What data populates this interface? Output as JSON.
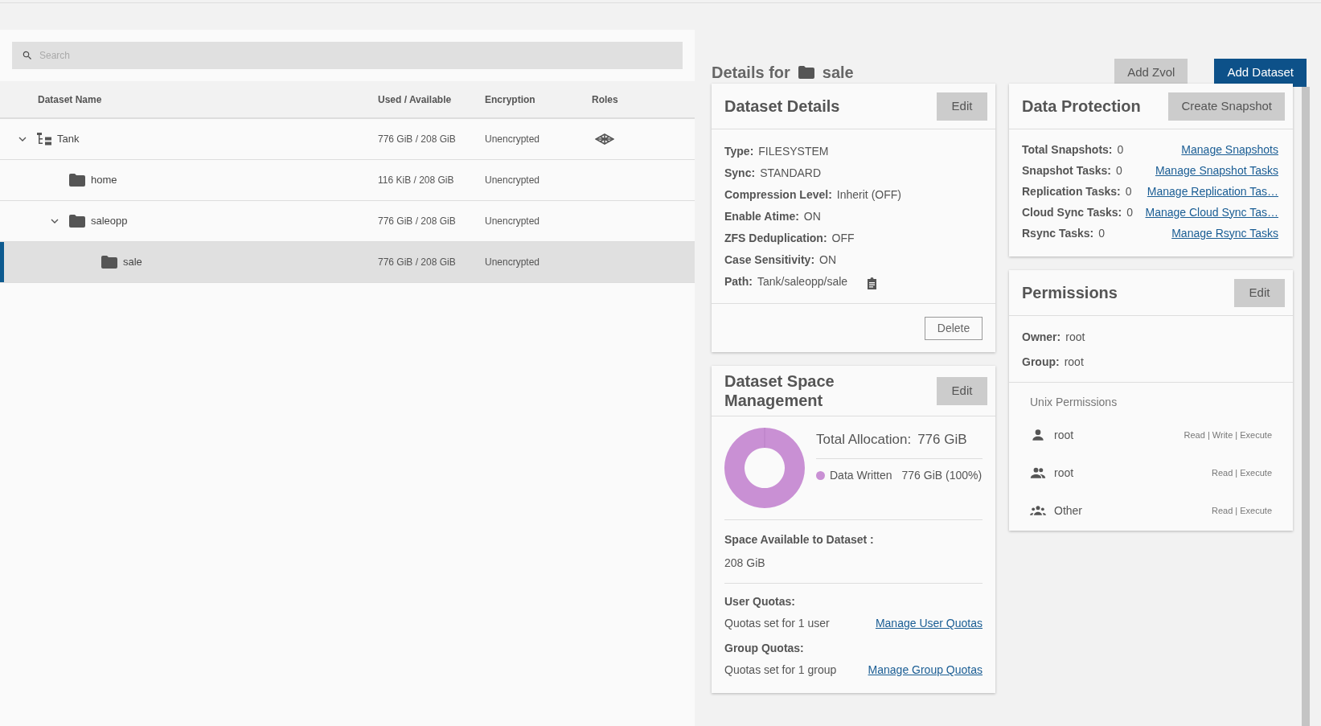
{
  "search": {
    "placeholder": "Search"
  },
  "table": {
    "columns": [
      "Dataset Name",
      "Used / Available",
      "Encryption",
      "Roles"
    ],
    "rows": [
      {
        "name": "Tank",
        "kind": "pool",
        "used": "776 GiB / 208 GiB",
        "encryption": "Unencrypted",
        "role_icon": true,
        "expanded": true,
        "selected": false,
        "children": [
          {
            "name": "home",
            "kind": "folder",
            "used": "116 KiB / 208 GiB",
            "encryption": "Unencrypted",
            "role_icon": false,
            "selected": false
          },
          {
            "name": "saleopp",
            "kind": "folder",
            "used": "776 GiB / 208 GiB",
            "encryption": "Unencrypted",
            "role_icon": false,
            "expanded": true,
            "selected": false,
            "children": [
              {
                "name": "sale",
                "kind": "folder",
                "used": "776 GiB / 208 GiB",
                "encryption": "Unencrypted",
                "role_icon": false,
                "selected": true
              }
            ]
          }
        ]
      }
    ]
  },
  "details_header": {
    "prefix": "Details for",
    "name": "sale",
    "buttons": [
      {
        "label": "Add Zvol",
        "primary": false
      },
      {
        "label": "Add Dataset",
        "primary": true
      }
    ]
  },
  "dataset_details": {
    "title": "Dataset Details",
    "edit": "Edit",
    "fields": [
      {
        "label": "Type:",
        "value": "FILESYSTEM"
      },
      {
        "label": "Sync:",
        "value": "STANDARD"
      },
      {
        "label": "Compression Level:",
        "value": "Inherit (OFF)"
      },
      {
        "label": "Enable Atime:",
        "value": "ON"
      },
      {
        "label": "ZFS Deduplication:",
        "value": "OFF"
      },
      {
        "label": "Case Sensitivity:",
        "value": "ON"
      },
      {
        "label": "Path:",
        "value": "Tank/saleopp/sale",
        "copy": true
      }
    ],
    "delete": "Delete"
  },
  "space_management": {
    "title": "Dataset Space Management",
    "edit": "Edit",
    "total_label": "Total Allocation:",
    "total_value": "776 GiB",
    "legend": [
      {
        "label": "Data Written",
        "value": "776 GiB (100%)",
        "color": "#c990d4"
      }
    ],
    "available_label": "Space Available to Dataset :",
    "available_value": "208 GiB",
    "quotas": [
      {
        "label": "User Quotas:",
        "text": "Quotas set for 1 user",
        "link": "Manage User Quotas"
      },
      {
        "label": "Group Quotas:",
        "text": "Quotas set for 1 group",
        "link": "Manage Group Quotas"
      }
    ]
  },
  "data_protection": {
    "title": "Data Protection",
    "button": "Create Snapshot",
    "rows": [
      {
        "label": "Total Snapshots:",
        "value": "0",
        "link": "Manage Snapshots"
      },
      {
        "label": "Snapshot Tasks:",
        "value": "0",
        "link": "Manage Snapshot Tasks"
      },
      {
        "label": "Replication Tasks:",
        "value": "0",
        "link": "Manage Replication Tas…"
      },
      {
        "label": "Cloud Sync Tasks:",
        "value": "0",
        "link": "Manage Cloud Sync Tas…"
      },
      {
        "label": "Rsync Tasks:",
        "value": "0",
        "link": "Manage Rsync Tasks"
      }
    ]
  },
  "permissions": {
    "title": "Permissions",
    "edit": "Edit",
    "fields": [
      {
        "label": "Owner:",
        "value": "root"
      },
      {
        "label": "Group:",
        "value": "root"
      }
    ],
    "section": "Unix Permissions",
    "entries": [
      {
        "kind": "user",
        "name": "root",
        "access": "Read | Write | Execute"
      },
      {
        "kind": "group",
        "name": "root",
        "access": "Read | Execute"
      },
      {
        "kind": "other",
        "name": "Other",
        "access": "Read | Execute"
      }
    ]
  }
}
